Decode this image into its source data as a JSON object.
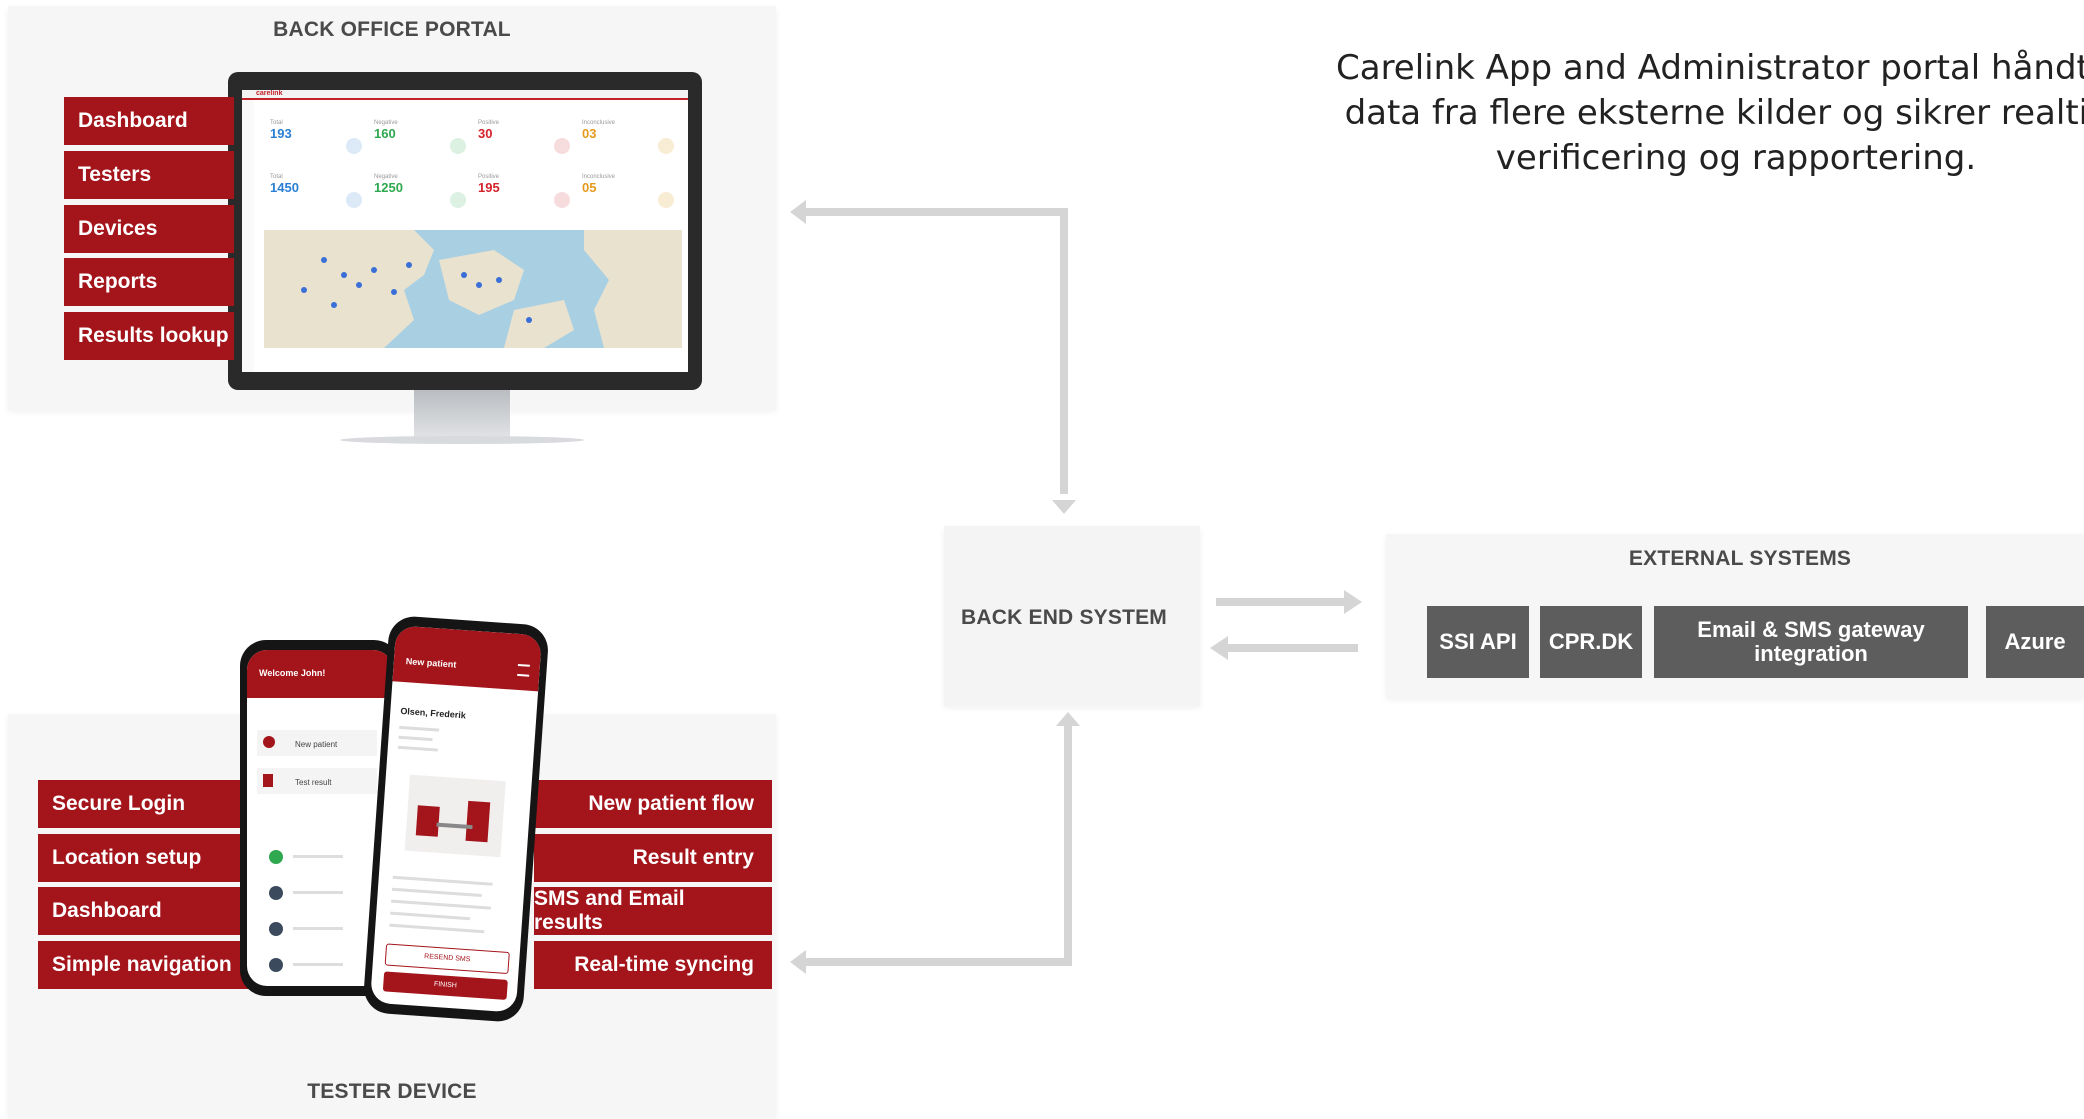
{
  "back_office": {
    "title": "BACK OFFICE PORTAL",
    "menu": [
      "Dashboard",
      "Testers",
      "Devices",
      "Reports",
      "Results lookup"
    ],
    "screen": {
      "brand": "carelink",
      "stats_row1": [
        {
          "label": "Total",
          "value": "193",
          "color": "#2a7fd4"
        },
        {
          "label": "Negative",
          "value": "160",
          "color": "#2fa84f"
        },
        {
          "label": "Positive",
          "value": "30",
          "color": "#d4232b"
        },
        {
          "label": "Inconclusive",
          "value": "03",
          "color": "#e69a1c"
        }
      ],
      "stats_row2": [
        {
          "label": "Total",
          "value": "1450",
          "color": "#2a7fd4"
        },
        {
          "label": "Negative",
          "value": "1250",
          "color": "#2fa84f"
        },
        {
          "label": "Positive",
          "value": "195",
          "color": "#d4232b"
        },
        {
          "label": "Inconclusive",
          "value": "05",
          "color": "#e69a1c"
        }
      ]
    }
  },
  "tester_device": {
    "title": "TESTER DEVICE",
    "left_menu": [
      "Secure Login",
      "Location setup",
      "Dashboard",
      "Simple navigation"
    ],
    "right_menu": [
      "New patient flow",
      "Result entry",
      "SMS and Email results",
      "Real-time syncing"
    ],
    "phone_back": {
      "header": "Welcome John!",
      "actions": [
        "New patient",
        "Test result"
      ]
    },
    "phone_front": {
      "header": "New patient",
      "patient": "Olsen, Frederik",
      "button_secondary": "RESEND SMS",
      "button_primary": "FINISH"
    }
  },
  "backend": {
    "title": "BACK END SYSTEM"
  },
  "external": {
    "title": "EXTERNAL SYSTEMS",
    "systems": [
      "SSI API",
      "CPR.DK",
      "Email & SMS gateway integration",
      "Azure"
    ]
  },
  "caption": {
    "lines": [
      "Carelink App and Administrator portal håndtere",
      "data fra flere eksterne kilder og sikrer realtids",
      "verificering og rapportering."
    ]
  },
  "colors": {
    "accent": "#a4141b",
    "ext_button": "#5d5d5d",
    "arrow": "#d5d5d5",
    "panel": "#f6f6f7"
  }
}
